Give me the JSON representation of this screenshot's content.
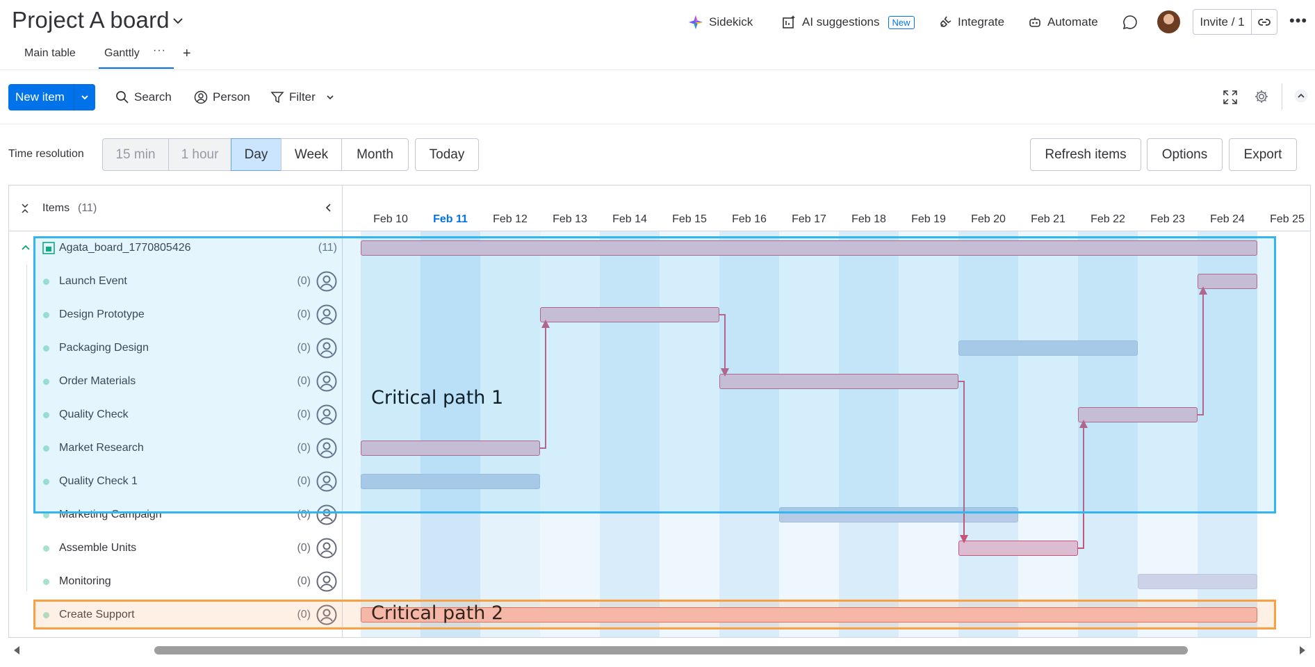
{
  "header": {
    "title": "Project A board",
    "actions": {
      "sidekick": "Sidekick",
      "ai": "AI suggestions",
      "ai_badge": "New",
      "integrate": "Integrate",
      "automate": "Automate"
    },
    "invite": "Invite / 1"
  },
  "views": {
    "main": "Main table",
    "ganttly": "Ganttly",
    "add": "+"
  },
  "toolbar": {
    "new_item": "New item",
    "search": "Search",
    "person": "Person",
    "filter": "Filter"
  },
  "controls": {
    "time_resolution": "Time resolution",
    "segments": [
      "15 min",
      "1 hour",
      "Day",
      "Week",
      "Month"
    ],
    "active_segment": "Day",
    "today": "Today",
    "refresh": "Refresh items",
    "options": "Options",
    "export": "Export"
  },
  "items": {
    "header": "Items",
    "count": "(11)",
    "group": {
      "name": "Agata_board_1770805426",
      "count": "(11)"
    },
    "rows": [
      {
        "name": "Launch Event",
        "count": "(0)"
      },
      {
        "name": "Design Prototype",
        "count": "(0)"
      },
      {
        "name": "Packaging Design",
        "count": "(0)"
      },
      {
        "name": "Order Materials",
        "count": "(0)"
      },
      {
        "name": "Quality Check",
        "count": "(0)"
      },
      {
        "name": "Market Research",
        "count": "(0)"
      },
      {
        "name": "Quality Check 1",
        "count": "(0)"
      },
      {
        "name": "Marketing Campaign",
        "count": "(0)"
      },
      {
        "name": "Assemble Units",
        "count": "(0)"
      },
      {
        "name": "Monitoring",
        "count": "(0)"
      },
      {
        "name": "Create Support",
        "count": "(0)"
      }
    ]
  },
  "timeline": {
    "partial_first": "9",
    "dates": [
      "Feb 10",
      "Feb 11",
      "Feb 12",
      "Feb 13",
      "Feb 14",
      "Feb 15",
      "Feb 16",
      "Feb 17",
      "Feb 18",
      "Feb 19",
      "Feb 20",
      "Feb 21",
      "Feb 22",
      "Feb 23",
      "Feb 24",
      "Feb 25"
    ],
    "today": "Feb 11"
  },
  "annotations": {
    "path1": "Critical path 1",
    "path2": "Critical path 2"
  },
  "colors": {
    "accent": "#0073ea",
    "critical": "#c35678",
    "highlight1": "#35b5f0",
    "highlight2": "#f7a044"
  }
}
